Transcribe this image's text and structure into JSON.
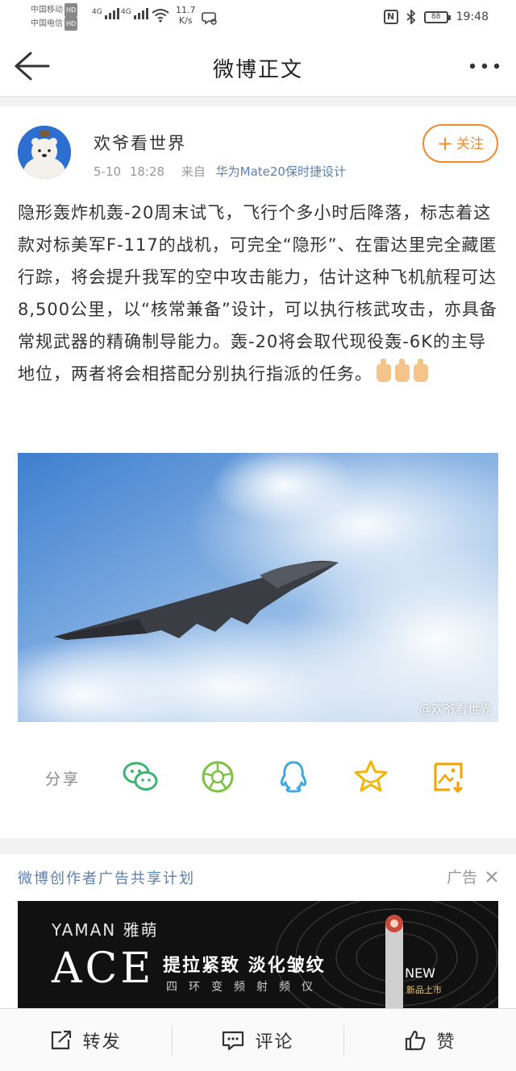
{
  "status_bar": {
    "carrier1": "中国移动",
    "carrier2": "中国电信",
    "hd": "HD",
    "net1": "4G",
    "net2": "4G",
    "speed_value": "11.7",
    "speed_unit": "K/s",
    "nfc": "N",
    "battery": "88",
    "time": "19:48"
  },
  "navbar": {
    "title": "微博正文"
  },
  "post": {
    "username": "欢爷看世界",
    "date": "5-10",
    "time": "18:28",
    "source_prefix": "来自",
    "source": "华为Mate20保时捷设计",
    "follow_label": "关注",
    "text": "隐形轰炸机轰-20周末试飞，飞行个多小时后降落，标志着这款对标美军F-117的战机，可完全“隐形”、在雷达里完全藏匿行踪，将会提升我军的空中攻击能力，估计这种飞机航程可达8,500公里，以“核常兼备”设计，可以执行核武攻击，亦具备常规武器的精确制导能力。轰-20将会取代现役轰-6K的主导地位，两者将会相搭配分别执行指派的任务。",
    "emoji": [
      "thumbs-up",
      "thumbs-up",
      "thumbs-up"
    ],
    "watermark": "@欢爷看世界"
  },
  "share": {
    "label": "分享",
    "targets": [
      "wechat",
      "moments",
      "qq",
      "favorite",
      "save-image"
    ]
  },
  "ad": {
    "title": "微博创作者广告共享计划",
    "label": "广告",
    "brand": "YAMAN 雅萌",
    "product": "ACE",
    "headline": "提拉紧致 淡化皱纹",
    "subline": "四环变频射频仪",
    "badge": "NEW",
    "badge_sub": "新品上市"
  },
  "bottom_bar": {
    "repost": "转发",
    "comment": "评论",
    "like": "赞"
  },
  "colors": {
    "accent_orange": "#f38a2e",
    "link_blue": "#5a7fb0",
    "wechat_green": "#3cb371",
    "qq_blue": "#3fa9e0",
    "star_gold": "#f5b400"
  }
}
